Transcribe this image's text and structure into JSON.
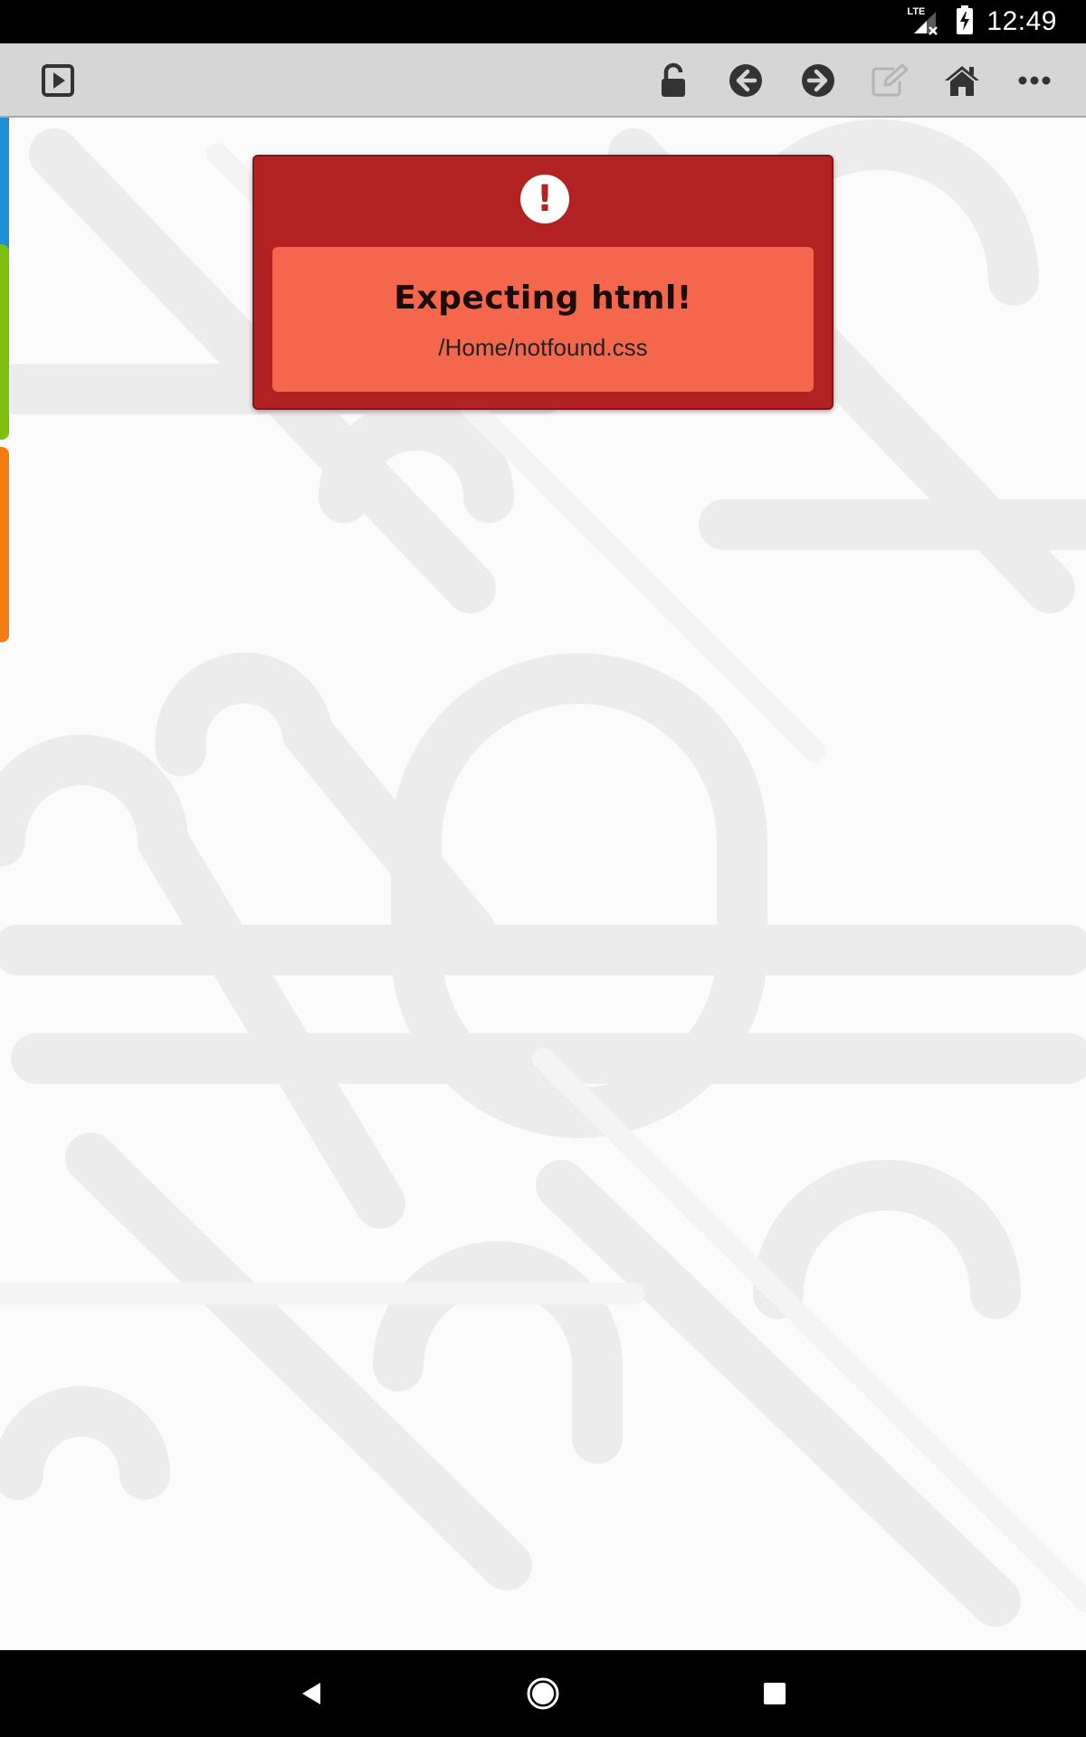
{
  "status_bar": {
    "network": "LTE",
    "time": "12:49"
  },
  "toolbar": {
    "left_icons": [
      "play-icon"
    ],
    "right_icons": [
      "unlock-icon",
      "back-arrow-icon",
      "forward-arrow-icon",
      "edit-icon",
      "home-icon",
      "more-icon"
    ]
  },
  "side_tabs": {
    "colors": [
      "#1e90d8",
      "#7ec00e",
      "#f57c13"
    ]
  },
  "error_dialog": {
    "title": "Expecting html!",
    "path": "/Home/notfound.css",
    "colors": {
      "frame": "#b22222",
      "body": "#f4674c"
    }
  },
  "nav_bar": {
    "icons": [
      "back-triangle-icon",
      "home-circle-icon",
      "recents-square-icon"
    ]
  }
}
